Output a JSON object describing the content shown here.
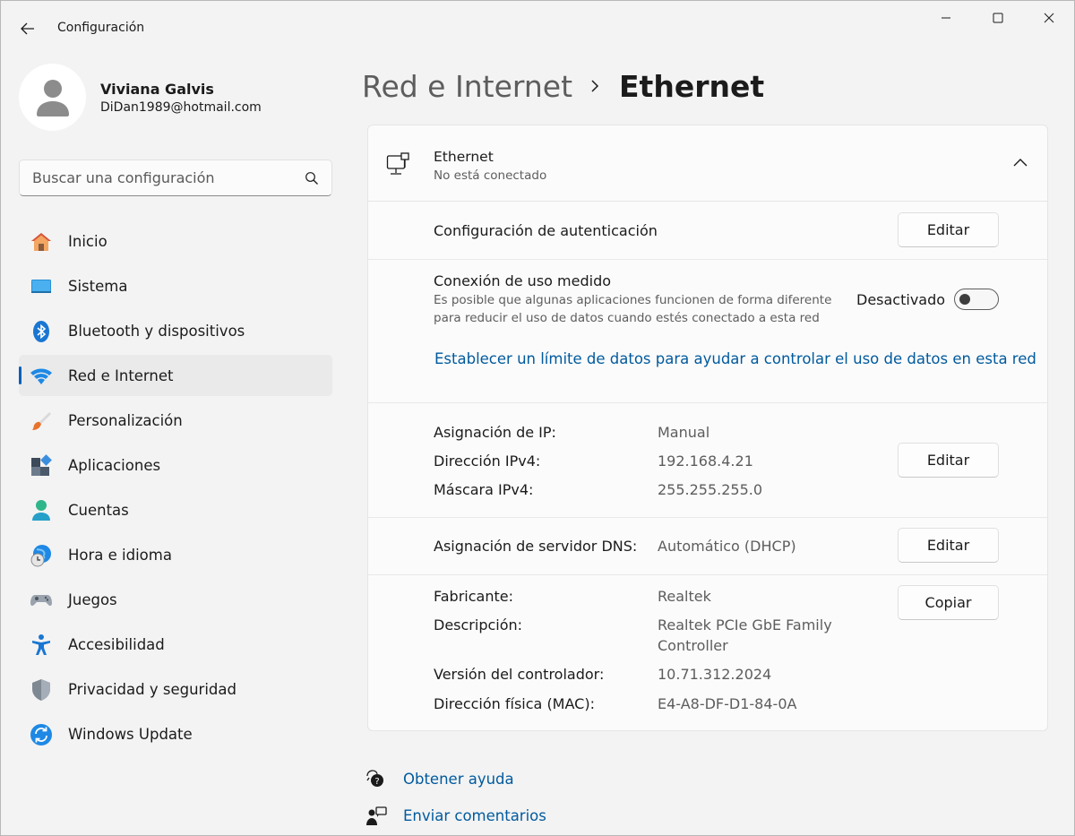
{
  "window": {
    "title": "Configuración"
  },
  "profile": {
    "name": "Viviana Galvis",
    "email": "DiDan1989@hotmail.com"
  },
  "search": {
    "placeholder": "Buscar una configuración"
  },
  "sidebar": {
    "items": [
      {
        "label": "Inicio",
        "icon": "home-icon"
      },
      {
        "label": "Sistema",
        "icon": "system-icon"
      },
      {
        "label": "Bluetooth y dispositivos",
        "icon": "bluetooth-icon"
      },
      {
        "label": "Red e Internet",
        "icon": "wifi-icon",
        "active": true
      },
      {
        "label": "Personalización",
        "icon": "brush-icon"
      },
      {
        "label": "Aplicaciones",
        "icon": "apps-icon"
      },
      {
        "label": "Cuentas",
        "icon": "accounts-icon"
      },
      {
        "label": "Hora e idioma",
        "icon": "time-language-icon"
      },
      {
        "label": "Juegos",
        "icon": "gamepad-icon"
      },
      {
        "label": "Accesibilidad",
        "icon": "accessibility-icon"
      },
      {
        "label": "Privacidad y seguridad",
        "icon": "shield-icon"
      },
      {
        "label": "Windows Update",
        "icon": "update-icon"
      }
    ]
  },
  "breadcrumb": {
    "parent": "Red e Internet",
    "current": "Ethernet"
  },
  "ethernet": {
    "title": "Ethernet",
    "status": "No está conectado",
    "auth": {
      "label": "Configuración de autenticación",
      "button": "Editar"
    },
    "metered": {
      "label": "Conexión de uso medido",
      "description": "Es posible que algunas aplicaciones funcionen de forma diferente para reducir el uso de datos cuando estés conectado a esta red",
      "state_label": "Desactivado",
      "enabled": false,
      "link": "Establecer un límite de datos para ayudar a controlar el uso de datos en esta red"
    },
    "ip": {
      "assignment_label": "Asignación de IP:",
      "assignment_value": "Manual",
      "ipv4_label": "Dirección IPv4:",
      "ipv4_value": "192.168.4.21",
      "mask_label": "Máscara IPv4:",
      "mask_value": "255.255.255.0",
      "button": "Editar"
    },
    "dns": {
      "label": "Asignación de servidor DNS:",
      "value": "Automático (DHCP)",
      "button": "Editar"
    },
    "hardware": {
      "manufacturer_label": "Fabricante:",
      "manufacturer_value": "Realtek",
      "description_label": "Descripción:",
      "description_line1": "Realtek PCIe GbE Family",
      "description_line2": "Controller",
      "driver_label": "Versión del controlador:",
      "driver_value": "10.71.312.2024",
      "mac_label": "Dirección física (MAC):",
      "mac_value": "E4-A8-DF-D1-84-0A",
      "button": "Copiar"
    }
  },
  "footer": {
    "help": "Obtener ayuda",
    "feedback": "Enviar comentarios"
  },
  "colors": {
    "accent": "#005fb8",
    "link": "#005a9e",
    "background": "#f3f3f3",
    "card": "#fbfbfb"
  }
}
